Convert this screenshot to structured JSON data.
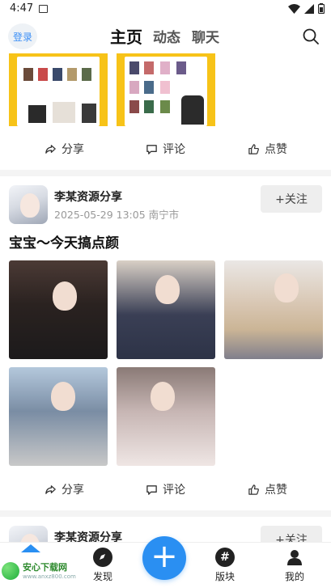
{
  "status_bar": {
    "time": "4:47"
  },
  "top_nav": {
    "login": "登录",
    "tabs": [
      {
        "label": "主页",
        "active": true
      },
      {
        "label": "动态",
        "active": false
      },
      {
        "label": "聊天",
        "active": false
      }
    ]
  },
  "actions": {
    "share": "分享",
    "comment": "评论",
    "like": "点赞"
  },
  "post": {
    "author": "李某资源分享",
    "date": "2025-05-29 13:05",
    "location": "南宁市",
    "follow": "+关注",
    "title": "宝宝～今天搞点颜",
    "image_count": 5
  },
  "next_post": {
    "author": "李某资源分享",
    "follow": "+关注"
  },
  "bottom_nav": {
    "items": [
      {
        "label": "发现",
        "icon": "compass-icon"
      },
      {
        "label": "版块",
        "icon": "hashtag-icon"
      },
      {
        "label": "我的",
        "icon": "person-icon"
      }
    ]
  },
  "watermark": {
    "title": "安心下载网",
    "url": "www.anxz800.com"
  },
  "colors": {
    "accent": "#2a8ff2",
    "yellow": "#f7c318"
  }
}
